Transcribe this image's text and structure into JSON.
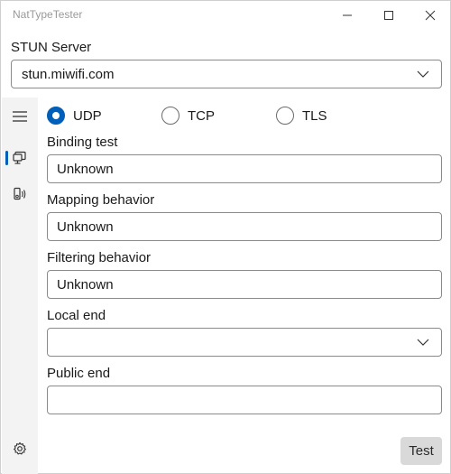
{
  "window": {
    "title": "NatTypeTester"
  },
  "stun": {
    "label": "STUN Server",
    "value": "stun.miwifi.com"
  },
  "protocols": [
    {
      "label": "UDP",
      "checked": true
    },
    {
      "label": "TCP",
      "checked": false
    },
    {
      "label": "TLS",
      "checked": false
    }
  ],
  "fields": {
    "binding_label": "Binding test",
    "binding_value": "Unknown",
    "mapping_label": "Mapping behavior",
    "mapping_value": "Unknown",
    "filtering_label": "Filtering behavior",
    "filtering_value": "Unknown",
    "local_label": "Local end",
    "local_value": "",
    "public_label": "Public end",
    "public_value": ""
  },
  "actions": {
    "test_label": "Test"
  },
  "nav": {
    "items": [
      "menu-icon",
      "network-monitor-icon",
      "device-speaker-icon",
      "gear-icon"
    ],
    "active": "network-monitor-icon"
  },
  "colors": {
    "accent": "#005fb8",
    "rail_bg": "#f3f3f3",
    "button_bg": "#d9d9d9"
  }
}
